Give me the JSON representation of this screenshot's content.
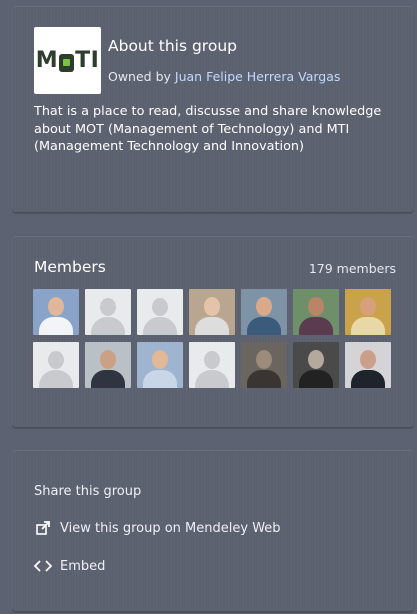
{
  "about": {
    "logo_text": "MOTI",
    "title": "About this group",
    "owned_by_label": "Owned by",
    "owner_name": "Juan Felipe Herrera Vargas",
    "description": "That is a place to read, discusse and share knowledge about MOT (Management of Technology) and MTI (Management Technology and Innovation)"
  },
  "members": {
    "title": "Members",
    "count": "179 members",
    "avatars": [
      {
        "type": "photo",
        "bg": "#8aa3c9",
        "skin": "#e0b79a",
        "shirt": "#f2f4f8"
      },
      {
        "type": "placeholder"
      },
      {
        "type": "placeholder"
      },
      {
        "type": "photo",
        "bg": "#b9a690",
        "skin": "#e4c3a8",
        "shirt": "#dddddd"
      },
      {
        "type": "photo",
        "bg": "#7f93a6",
        "skin": "#d9a98a",
        "shirt": "#3c5a7a"
      },
      {
        "type": "photo",
        "bg": "#6f8f6a",
        "skin": "#b98566",
        "shirt": "#5a3c4e"
      },
      {
        "type": "photo",
        "bg": "#c9a24a",
        "skin": "#d6a07a",
        "shirt": "#e8d8a6"
      },
      {
        "type": "placeholder"
      },
      {
        "type": "photo",
        "bg": "#b9c0c6",
        "skin": "#caa184",
        "shirt": "#2f3440"
      },
      {
        "type": "photo",
        "bg": "#9fb4cf",
        "skin": "#e2b896",
        "shirt": "#c9d6e8"
      },
      {
        "type": "placeholder"
      },
      {
        "type": "photo",
        "bg": "#6b6560",
        "skin": "#9c8a7a",
        "shirt": "#3a3532"
      },
      {
        "type": "photo",
        "bg": "#4a4a4a",
        "skin": "#b5a89c",
        "shirt": "#222222"
      },
      {
        "type": "photo",
        "bg": "#d4d4d6",
        "skin": "#caa08a",
        "shirt": "#1f232b"
      }
    ]
  },
  "share": {
    "title": "Share this group",
    "view_link": "View this group on Mendeley Web",
    "embed_link": "Embed",
    "view_icon": "external-link-icon",
    "embed_icon": "code-icon"
  }
}
